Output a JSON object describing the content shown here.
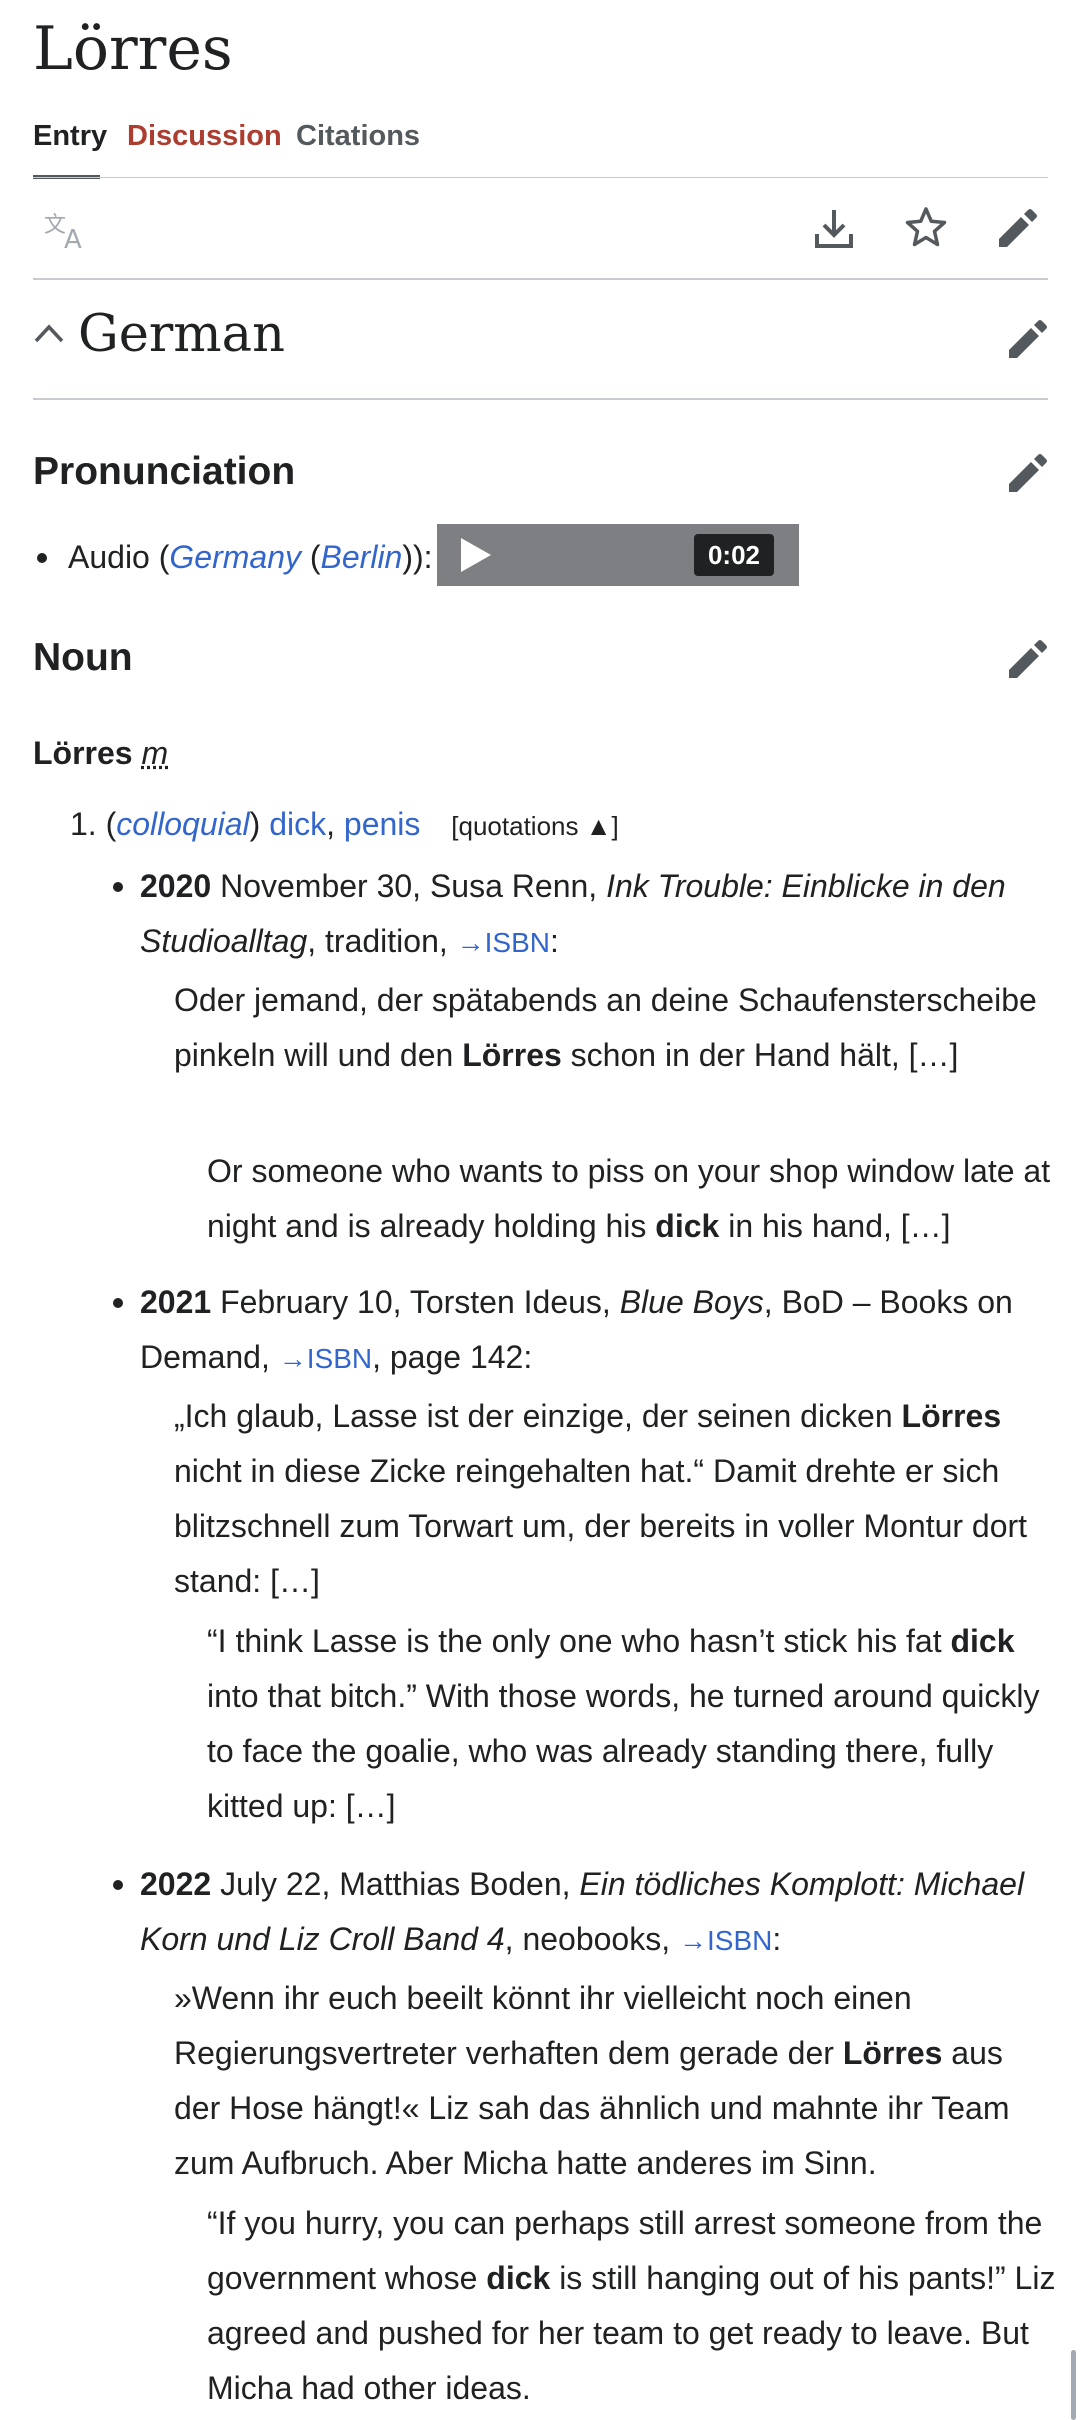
{
  "page": {
    "title": "Lörres",
    "tabs": [
      {
        "label": "Entry",
        "active": true
      },
      {
        "label": "Discussion",
        "color": "#ac3d30"
      },
      {
        "label": "Citations"
      }
    ],
    "toolbar_icons": [
      "translate-icon",
      "download-icon",
      "star-icon",
      "edit-icon"
    ]
  },
  "language": {
    "name": "German"
  },
  "pronunciation": {
    "heading": "Pronunciation",
    "audio_prefix": "Audio (",
    "audio_place": "Germany",
    "audio_city": "Berlin",
    "audio_suffix": ")):",
    "duration": "0:02"
  },
  "noun": {
    "heading": "Noun",
    "headword": "Lörres",
    "gender": "m",
    "sense": {
      "number": "1.",
      "label": "colloquial",
      "gloss1": "dick",
      "gloss2": "penis",
      "quotations_toggle": "[quotations ▲]"
    }
  },
  "citations": [
    {
      "year": "2020",
      "date": "November 30, Susa Renn,",
      "title": "Ink Trouble: Einblicke in den Studioalltag",
      "publisher": ", tradition,",
      "isbn": "→ISBN",
      "after": ":",
      "quote_a": "Oder jemand, der spätabends an deine Schaufensterscheibe pinkeln will und den",
      "quote_bold": "Lörres",
      "quote_b": "schon in der Hand hält, […]",
      "trans_a": "Or someone who wants to piss on your shop window late at night and is already holding his",
      "trans_bold": "dick",
      "trans_b": "in his hand, […]"
    },
    {
      "year": "2021",
      "date": "February 10, Torsten Ideus,",
      "title": "Blue Boys",
      "publisher": ", BoD – Books on Demand,",
      "isbn": "→ISBN",
      "after": ", page 142:",
      "quote_a": "„Ich glaub, Lasse ist der einzige, der seinen dicken",
      "quote_bold": "Lörres",
      "quote_b": "nicht in diese Zicke reingehalten hat.“ Damit drehte er sich blitzschnell zum Torwart um, der bereits in voller Montur dort stand: […]",
      "trans_a": "“I think Lasse is the only one who hasn’t stick his fat",
      "trans_bold": "dick",
      "trans_b": "into that bitch.” With those words, he turned around quickly to face the goalie, who was already standing there, fully kitted up: […]"
    },
    {
      "year": "2022",
      "date": "July 22, Matthias Boden,",
      "title": "Ein tödliches Komplott: Michael Korn und Liz Croll Band 4",
      "publisher": ", neobooks,",
      "isbn": "→ISBN",
      "after": ":",
      "quote_a": "»Wenn ihr euch beeilt könnt ihr vielleicht noch einen Regierungsvertreter verhaften dem gerade der",
      "quote_bold": "Lörres",
      "quote_b": "aus der Hose hängt!« Liz sah das ähnlich und mahnte ihr Team zum Aufbruch. Aber Micha hatte anderes im Sinn.",
      "trans_a": "“If you hurry, you can perhaps still arrest someone from the government whose",
      "trans_bold": "dick",
      "trans_b": "is still hanging out of his pants!” Liz agreed and pushed for her team to get ready to leave. But Micha had other ideas."
    }
  ]
}
